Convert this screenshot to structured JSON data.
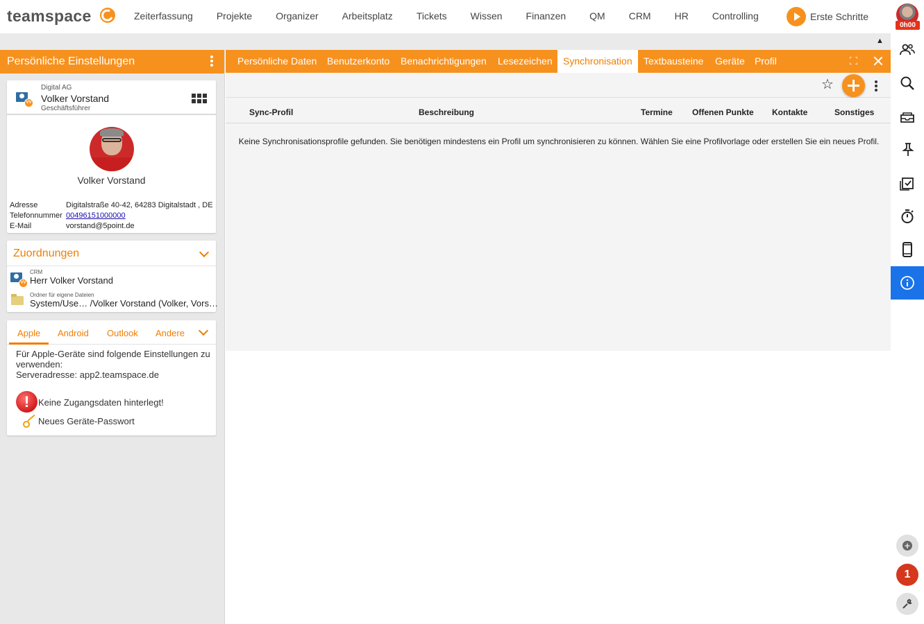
{
  "app": {
    "logo": "teamspace"
  },
  "nav": {
    "items": [
      "Zeiterfassung",
      "Projekte",
      "Organizer",
      "Arbeitsplatz",
      "Tickets",
      "Wissen",
      "Finanzen",
      "QM",
      "CRM",
      "HR",
      "Controlling"
    ],
    "first_steps": "Erste Schritte",
    "timer": "0h00"
  },
  "left_panel": {
    "title": "Persönliche Einstellungen",
    "profile": {
      "company": "Digital AG",
      "name": "Volker Vorstand",
      "role": "Geschäftsführer",
      "full_name": "Volker Vorstand",
      "address_label": "Adresse",
      "address": "Digitalstraße 40-42, 64283 Digitalstadt , DE",
      "phone_label": "Telefonnummer",
      "phone": "00496151000000",
      "email_label": "E-Mail",
      "email": "vorstand@5point.de"
    },
    "assignments": {
      "title": "Zuordnungen",
      "crm_label": "CRM",
      "crm_value": "Herr Volker Vorstand",
      "folder_label": "Ordner für eigene Dateien",
      "folder_value": "System/Use… /Volker Vorstand (Volker, Vors…"
    },
    "devices": {
      "tabs": [
        "Apple",
        "Android",
        "Outlook",
        "Andere"
      ],
      "active_tab": "Apple",
      "intro": "Für Apple-Geräte sind folgende Einstellungen zu verwenden:",
      "server": "Serveradresse: app2.teamspace.de",
      "warning": "Keine Zugangsdaten hinterlegt!",
      "new_password": "Neues Geräte-Passwort"
    }
  },
  "main": {
    "tabs": [
      "Persönliche Daten",
      "Benutzerkonto",
      "Benachrichtigungen",
      "Lesezeichen",
      "Synchronisation",
      "Textbausteine",
      "Geräte",
      "Profil"
    ],
    "active_tab": "Synchronisation",
    "columns": [
      "Sync-Profil",
      "Beschreibung",
      "Termine",
      "Offenen Punkte",
      "Kontakte",
      "Sonstiges"
    ],
    "empty_message": "Keine Synchronisationsprofile gefunden. Sie benötigen mindestens ein Profil um synchronisieren zu können. Wählen Sie eine Profilvorlage oder erstellen Sie ein neues Profil."
  },
  "right_bar": {
    "icons": [
      "contacts-icon",
      "search-icon",
      "inbox-icon",
      "pin-icon",
      "tasks-icon",
      "timer-icon",
      "mobile-icon",
      "info-icon"
    ],
    "active": "info-icon",
    "notification_count": "1"
  },
  "colors": {
    "accent": "#f7911e",
    "active_blue": "#1a73e8",
    "alert_red": "#d5381d"
  }
}
